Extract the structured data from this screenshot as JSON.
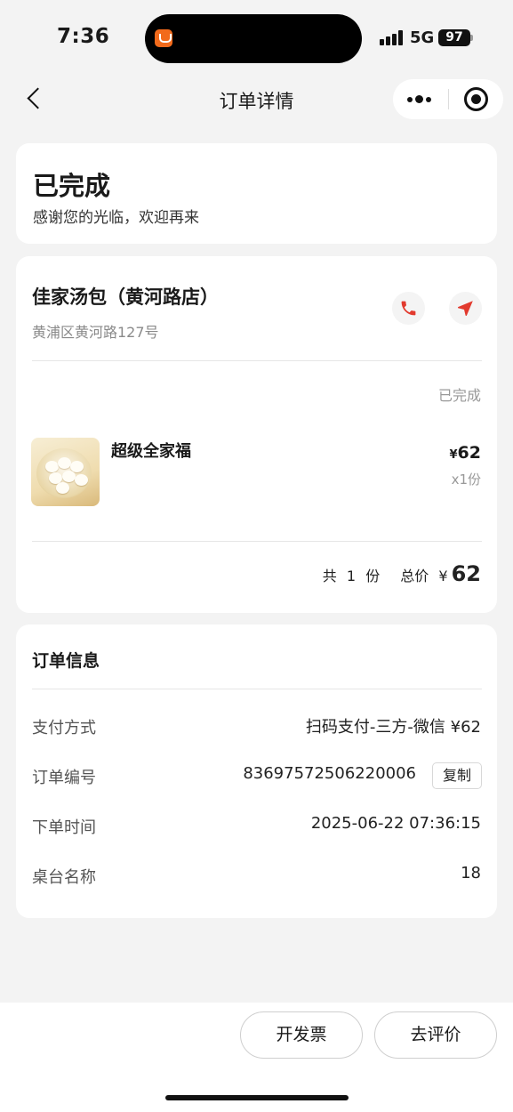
{
  "status_bar": {
    "time": "7:36",
    "network": "5G",
    "battery": "97"
  },
  "nav": {
    "title": "订单详情"
  },
  "status_card": {
    "title": "已完成",
    "subtitle": "感谢您的光临，欢迎再来"
  },
  "store": {
    "name": "佳家汤包（黄河路店）",
    "address": "黄浦区黄河路127号",
    "order_status": "已完成",
    "items": [
      {
        "name": "超级全家福",
        "currency": "¥",
        "price": "62",
        "qty": "x1份"
      }
    ],
    "summary": {
      "count_prefix": "共",
      "count": "1",
      "count_unit": "份",
      "total_label": "总价",
      "currency": "¥",
      "total": "62"
    }
  },
  "order_info": {
    "title": "订单信息",
    "rows": [
      {
        "label": "支付方式",
        "value": "扫码支付-三方-微信 ¥62"
      },
      {
        "label": "订单编号",
        "value": "83697572506220006"
      },
      {
        "label": "下单时间",
        "value": "2025-06-22 07:36:15"
      },
      {
        "label": "桌台名称",
        "value": "18"
      }
    ],
    "copy_label": "复制"
  },
  "actions": {
    "invoice": "开发票",
    "review": "去评价"
  },
  "icons": [
    "back-icon",
    "more-icon",
    "target-icon",
    "phone-icon",
    "navigation-arrow-icon"
  ],
  "colors": {
    "accent_red": "#e23a2e",
    "background": "#f3f3f3"
  }
}
